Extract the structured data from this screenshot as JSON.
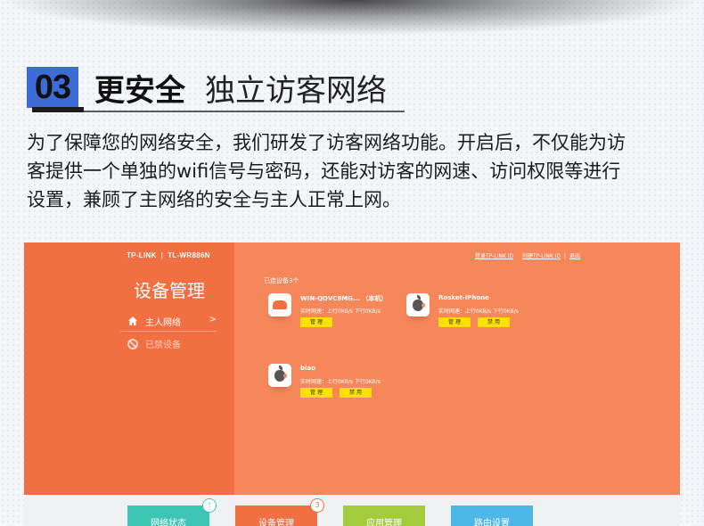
{
  "section": {
    "number": "03",
    "title_strong": "更安全",
    "title_light": "独立访客网络",
    "intro_lines": [
      "为了保障您的网络安全，我们研发了访客网络功能。开启后，不仅能为访",
      "客提供一个单独的wifi信号与密码，还能对访客的网速、访问权限等进行",
      "设置，兼顾了主网络的安全与主人正常上网。"
    ]
  },
  "router_ui": {
    "brand": "TP-LINK",
    "model": "TL-WR886N",
    "top_links": [
      "登录TP-LINK ID",
      "创建TP-LINK ID",
      "退出"
    ],
    "sidebar": {
      "title": "设备管理",
      "items": [
        {
          "label": "主人网络",
          "chevron": ">",
          "icon": "home-icon"
        },
        {
          "label": "已禁设备",
          "icon": "ban-icon"
        }
      ]
    },
    "connected_label": "已连设备3个",
    "devices": [
      {
        "name": "WIN-QDVC8MG... （本机）",
        "speed": "实时网速：上行0KB/s 下行0KB/s",
        "icon": "computer-icon",
        "buttons": [
          "管 理"
        ]
      },
      {
        "name": "Rosket-iPhone",
        "speed": "实时网速：上行0KB/s 下行0KB/s",
        "icon": "apple-icon",
        "buttons": [
          "管 理",
          "禁 用"
        ]
      },
      {
        "name": "biao",
        "speed": "实时网速：上行0KB/s 下行0KB/s",
        "icon": "apple-icon",
        "buttons": [
          "管 理",
          "禁 用"
        ]
      }
    ],
    "nav_tabs": [
      {
        "label": "网络状态",
        "badge": "!",
        "color": "#3ec6b4"
      },
      {
        "label": "设备管理",
        "badge": "3",
        "color": "#f26f42"
      },
      {
        "label": "应用管理",
        "color": "#a4cc3c"
      },
      {
        "label": "路由设置",
        "color": "#4db8e8"
      }
    ]
  },
  "colors": {
    "accent_blue": "#3d6bd8",
    "sidebar_orange": "#f26f42",
    "main_orange": "#f5875a",
    "button_yellow": "#ffe000"
  }
}
